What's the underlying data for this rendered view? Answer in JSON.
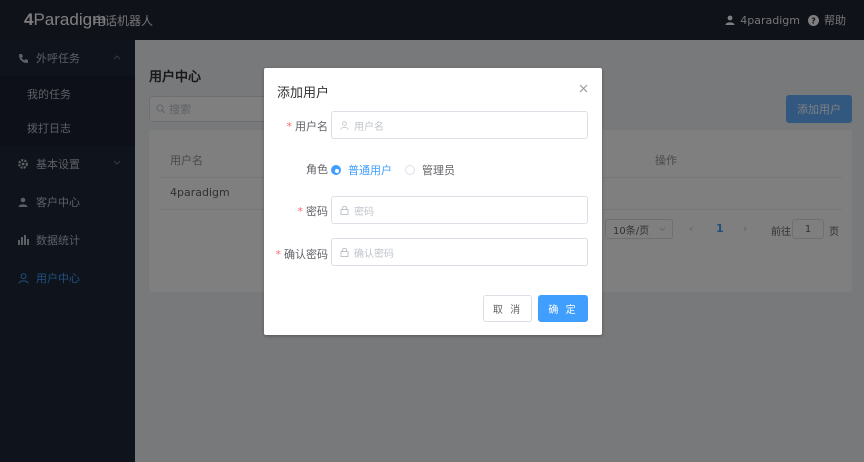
{
  "header": {
    "logo_prefix": "4",
    "logo_rest": "Paradigm",
    "app_name": "电话机器人",
    "username": "4paradigm",
    "help_label": "帮助"
  },
  "sidebar": {
    "items": [
      {
        "label": "外呼任务",
        "icon": "phone-icon",
        "expandable": true
      },
      {
        "label": "我的任务"
      },
      {
        "label": "拨打日志"
      },
      {
        "label": "基本设置",
        "icon": "gear-icon",
        "expandable": true
      },
      {
        "label": "客户中心",
        "icon": "person-icon"
      },
      {
        "label": "数据统计",
        "icon": "bar-chart-icon"
      },
      {
        "label": "用户中心",
        "icon": "user-outline-icon",
        "active": true
      }
    ]
  },
  "main": {
    "title": "用户中心",
    "search_placeholder": "搜索",
    "add_button": "添加用户",
    "table": {
      "col_username": "用户名",
      "col_actions": "操作",
      "rows": [
        {
          "username": "4paradigm"
        }
      ]
    },
    "pagination": {
      "page_size": "10条/页",
      "current_page": "1",
      "goto_label": "前往",
      "goto_value": "1",
      "page_suffix": "页"
    }
  },
  "modal": {
    "title": "添加用户",
    "username_label": "用户名",
    "username_placeholder": "用户名",
    "role_label": "角色",
    "role_normal": "普通用户",
    "role_admin": "管理员",
    "password_label": "密码",
    "password_placeholder": "密码",
    "confirm_label": "确认密码",
    "confirm_placeholder": "确认密码",
    "cancel": "取 消",
    "ok": "确 定",
    "required_mark": "*"
  },
  "colors": {
    "primary": "#409eff",
    "header_bg": "#1e2433",
    "sidebar_bg": "#1f2839",
    "required": "#f56c6c"
  }
}
